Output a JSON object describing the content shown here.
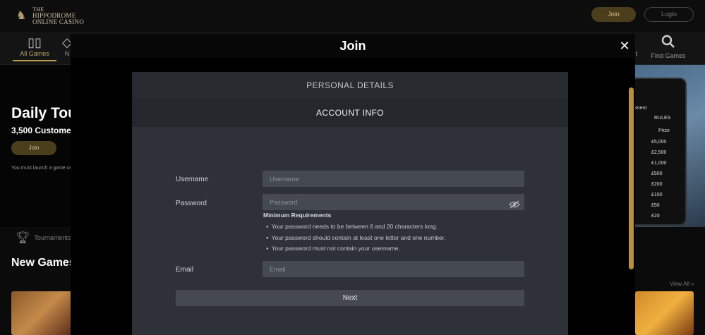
{
  "site": {
    "logo": {
      "line1": "THE",
      "line2": "HIPPODROME",
      "line3": "ONLINE CASINO"
    },
    "header": {
      "join_label": "Join",
      "login_label": "Login"
    },
    "nav": {
      "all_games": "All Games",
      "n_fragment": "N",
      "t_fragment": "t",
      "find_games": "Find Games"
    },
    "hero": {
      "title": "Daily Tou",
      "subtitle": "3,500 Custome",
      "join_label": "Join",
      "note": "You must launch a game on"
    },
    "phone_values": [
      "ement",
      "RULES",
      "Prize",
      "£5,000",
      "£2,500",
      "£1,000",
      "£500",
      "£200",
      "£100",
      "£50",
      "£20"
    ],
    "tournaments_label": "Tournaments",
    "new_games_heading": "New Games",
    "view_all": "View All »"
  },
  "modal": {
    "title": "Join",
    "steps": {
      "personal": "PERSONAL DETAILS",
      "account": "ACCOUNT INFO"
    },
    "username": {
      "label": "Username",
      "placeholder": "Username"
    },
    "password": {
      "label": "Password",
      "placeholder": "Password"
    },
    "requirements": {
      "title": "Minimum Requirements",
      "items": [
        "Your password needs to be between 6 and 20 characters long.",
        "Your password should contain at least one letter and one number.",
        "Your password must not contain your username."
      ]
    },
    "email": {
      "label": "Email",
      "placeholder": "Email"
    },
    "next_label": "Next"
  },
  "colors": {
    "accent_gold": "#b8923a",
    "panel_bg": "#2e3238",
    "input_bg": "#454a51"
  }
}
